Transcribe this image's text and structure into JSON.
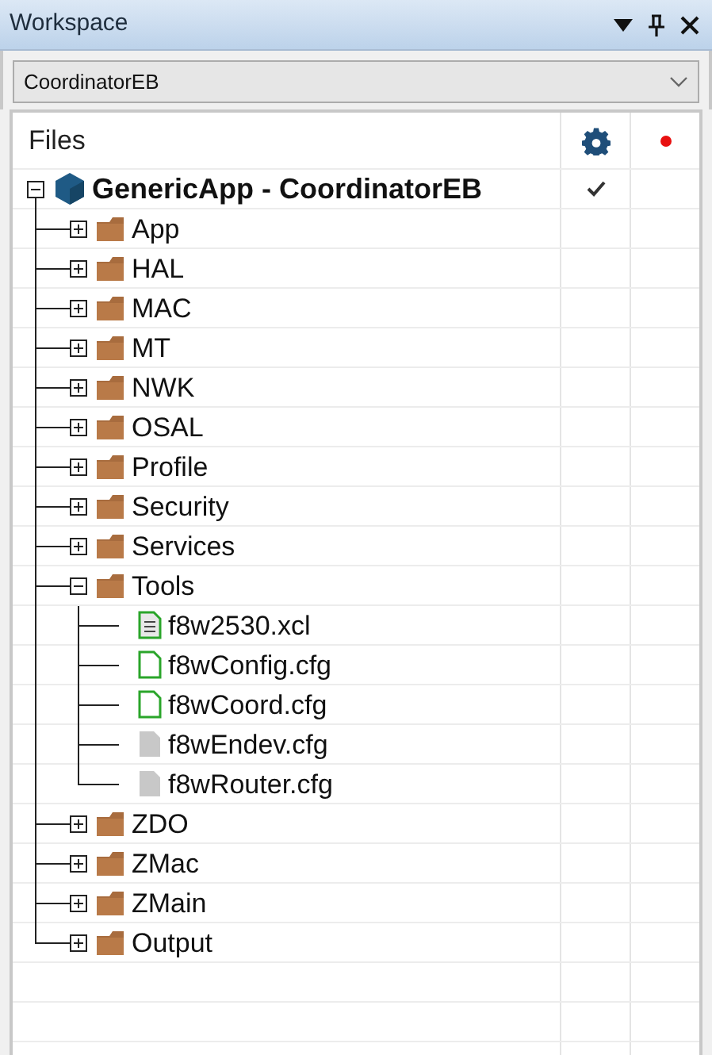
{
  "window": {
    "title": "Workspace"
  },
  "configuration": {
    "value": "CoordinatorEB"
  },
  "tree": {
    "column": "Files",
    "root": {
      "label": "GenericApp - CoordinatorEB",
      "expanded": true,
      "checked": true,
      "children": [
        {
          "label": "App",
          "kind": "folder",
          "expanded": false
        },
        {
          "label": "HAL",
          "kind": "folder",
          "expanded": false
        },
        {
          "label": "MAC",
          "kind": "folder",
          "expanded": false
        },
        {
          "label": "MT",
          "kind": "folder",
          "expanded": false
        },
        {
          "label": "NWK",
          "kind": "folder",
          "expanded": false
        },
        {
          "label": "OSAL",
          "kind": "folder",
          "expanded": false
        },
        {
          "label": "Profile",
          "kind": "folder",
          "expanded": false
        },
        {
          "label": "Security",
          "kind": "folder",
          "expanded": false
        },
        {
          "label": "Services",
          "kind": "folder",
          "expanded": false
        },
        {
          "label": "Tools",
          "kind": "folder",
          "expanded": true,
          "children": [
            {
              "label": "f8w2530.xcl",
              "kind": "lined-file"
            },
            {
              "label": "f8wConfig.cfg",
              "kind": "outline-file"
            },
            {
              "label": "f8wCoord.cfg",
              "kind": "outline-file"
            },
            {
              "label": "f8wEndev.cfg",
              "kind": "grey-file"
            },
            {
              "label": "f8wRouter.cfg",
              "kind": "grey-file"
            }
          ]
        },
        {
          "label": "ZDO",
          "kind": "folder",
          "expanded": false
        },
        {
          "label": "ZMac",
          "kind": "folder",
          "expanded": false
        },
        {
          "label": "ZMain",
          "kind": "folder",
          "expanded": false
        },
        {
          "label": "Output",
          "kind": "folder",
          "expanded": false
        }
      ]
    }
  }
}
